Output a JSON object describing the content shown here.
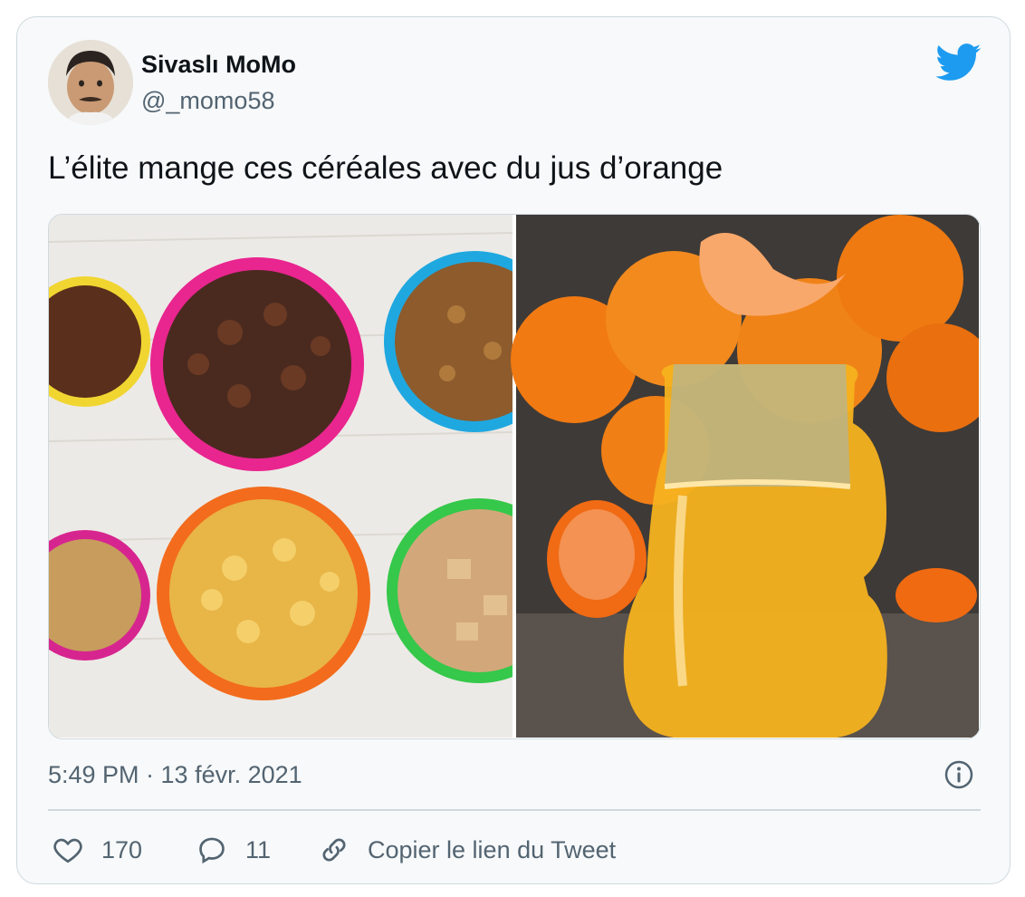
{
  "tweet": {
    "author_name": "Sivaslı MoMo",
    "author_handle": "@_momo58",
    "text": "L’élite mange ces céréales avec du jus d’orange",
    "timestamp": "5:49 PM · 13 févr. 2021"
  },
  "actions": {
    "likes": "170",
    "replies": "11",
    "copy_link": "Copier le lien du Tweet"
  },
  "media": [
    {
      "label": "cereal-bowls-photo"
    },
    {
      "label": "orange-juice-photo"
    }
  ],
  "colors": {
    "twitter_blue": "#1d9bf0",
    "text": "#0f1419",
    "secondary": "#536471"
  }
}
